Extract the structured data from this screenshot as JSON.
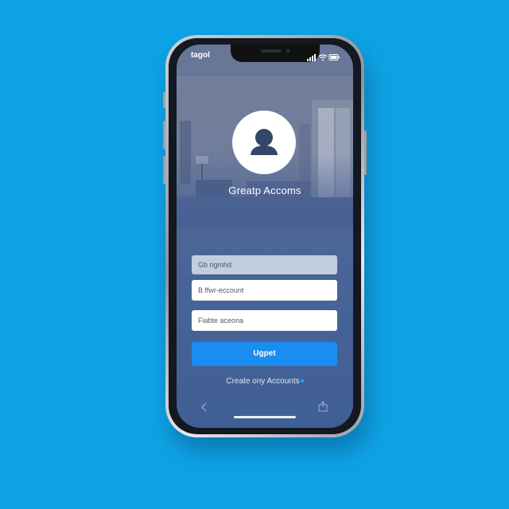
{
  "status_bar": {
    "time": "tagol"
  },
  "profile": {
    "title": "Greatp Accoms"
  },
  "form": {
    "field1_placeholder": "Gb ngmhd",
    "field2_placeholder": "B ffwr-eccount",
    "field3_placeholder": "Fiabte aceona",
    "button_label": "Ugpet",
    "create_account_link": "Create ony Accounts"
  },
  "icons": [
    "signal-icon",
    "wifi-icon",
    "battery-icon",
    "avatar-icon",
    "back-icon",
    "share-icon"
  ],
  "colors": {
    "background": "#0ea3e6",
    "primary_button": "#1a8df0",
    "screen": "#4a6597"
  }
}
